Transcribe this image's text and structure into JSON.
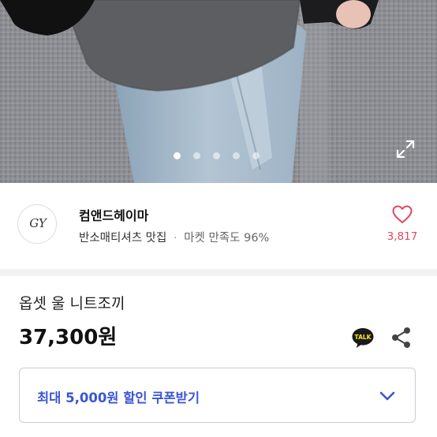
{
  "gallery": {
    "dot_count": 5,
    "active_index": 0,
    "expand_icon": "expand-icon"
  },
  "seller": {
    "logo_text": "GY",
    "name": "컴앤드헤이마",
    "tagline": "반소매티셔츠 맛집",
    "separator": "·",
    "satisfaction": "마켓 만족도 96%",
    "like_count": "3,817",
    "like_icon": "heart-outline-icon"
  },
  "product": {
    "name": "옵셋 울 니트조끼",
    "price": "37,300원",
    "talk_badge": "TALK",
    "share_icon": "share-icon"
  },
  "coupon": {
    "label": "최대 5,000원 할인 쿠폰받기",
    "chevron_icon": "chevron-down-icon"
  },
  "colors": {
    "brand_blue": "#3a56d4",
    "like_pink": "#e04860",
    "talk_yellow": "#ffe812"
  }
}
